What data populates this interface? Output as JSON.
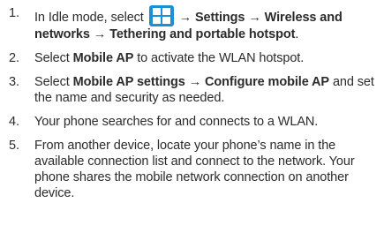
{
  "steps": [
    {
      "num": "1.",
      "pre": "In Idle mode, select",
      "icon": "apps-grid-icon",
      "arrow1": "→",
      "b1": "Settings",
      "arrow2": "→",
      "b2": "Wireless and networks",
      "arrow3": "→",
      "b3": "Tethering and portable hotspot",
      "end": "."
    },
    {
      "num": "2.",
      "pre": "Select",
      "b1": "Mobile AP",
      "post": "to activate the WLAN hotspot."
    },
    {
      "num": "3.",
      "pre": "Select",
      "b1": "Mobile AP settings",
      "arrow": "→",
      "b2": "Configure mobile AP",
      "post": "and set the name and security as needed."
    },
    {
      "num": "4.",
      "text": "Your phone searches for and connects to a WLAN."
    },
    {
      "num": "5.",
      "text": "From another device, locate your phone’s name in the available connection list and connect to the network. Your phone shares the mobile network connection on another device."
    }
  ],
  "colors": {
    "text": "#2b2b2b",
    "icon_blue": "#1e8fd6",
    "icon_white": "#ffffff"
  }
}
